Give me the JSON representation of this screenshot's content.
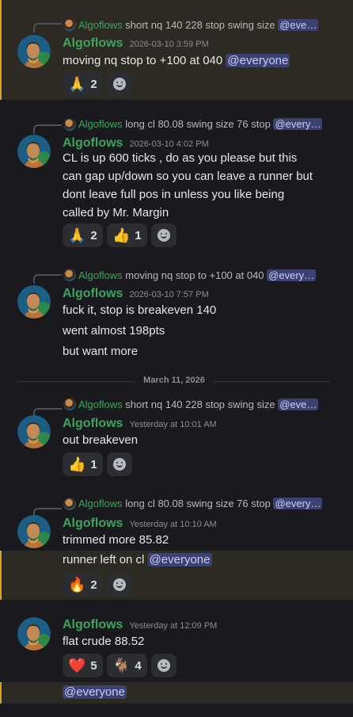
{
  "messages": [
    {
      "reply_author": "Algoflows",
      "reply_text": "short nq 140 228 stop  swing size",
      "reply_mention": "@eve…",
      "author": "Algoflows",
      "timestamp": "2026-03-10 3:59 PM",
      "lines": [
        "moving nq stop to +100 at 040 "
      ],
      "mention": "@everyone",
      "reactions": [
        {
          "emoji": "🙏",
          "count": "2"
        }
      ],
      "highlighted": true
    },
    {
      "reply_author": "Algoflows",
      "reply_text": "long cl 80.08 swing size 76 stop",
      "reply_mention": "@every…",
      "author": "Algoflows",
      "timestamp": "2026-03-10 4:02 PM",
      "lines": [
        "CL is up 600 ticks , do as you please but this",
        "can gap up/down so you can leave a runner but",
        "dont leave full pos in unless you like being",
        "called by Mr. Margin"
      ],
      "reactions": [
        {
          "emoji": "🙏",
          "count": "2"
        },
        {
          "emoji": "👍",
          "count": "1"
        }
      ]
    },
    {
      "reply_author": "Algoflows",
      "reply_text": "moving nq stop to +100 at 040",
      "reply_mention": "@every…",
      "author": "Algoflows",
      "timestamp": "2026-03-10 7:57 PM",
      "lines": [
        "fuck it, stop is breakeven 140",
        "went almost 198pts",
        "but want more"
      ]
    },
    {
      "reply_author": "Algoflows",
      "reply_text": "short nq 140 228 stop  swing size",
      "reply_mention": "@eve…",
      "author": "Algoflows",
      "timestamp": "Yesterday at 10:01 AM",
      "lines": [
        "out breakeven"
      ],
      "reactions": [
        {
          "emoji": "👍",
          "count": "1"
        }
      ]
    },
    {
      "reply_author": "Algoflows",
      "reply_text": "long cl 80.08 swing size 76 stop",
      "reply_mention": "@every…",
      "author": "Algoflows",
      "timestamp": "Yesterday at 10:10 AM",
      "lines": [
        "trimmed more 85.82"
      ],
      "followup_text": "runner left on cl ",
      "followup_mention": "@everyone",
      "reactions": [
        {
          "emoji": "🔥",
          "count": "2"
        }
      ]
    },
    {
      "author": "Algoflows",
      "timestamp": "Yesterday at 12:09 PM",
      "lines": [
        "flat crude 88.52"
      ],
      "reactions": [
        {
          "emoji": "❤️",
          "count": "5"
        },
        {
          "emoji": "🐐",
          "count": "4"
        }
      ],
      "followup_mention": "@everyone"
    }
  ],
  "date_divider": "March 11, 2026",
  "colors": {
    "background": "#1a1a1e",
    "author": "#3ba55d",
    "highlight": "#2c2a22",
    "highlight_bar": "#d6a229",
    "mention_bg": "#3c4270"
  },
  "icons": {
    "add_reaction": "add-reaction-icon"
  }
}
